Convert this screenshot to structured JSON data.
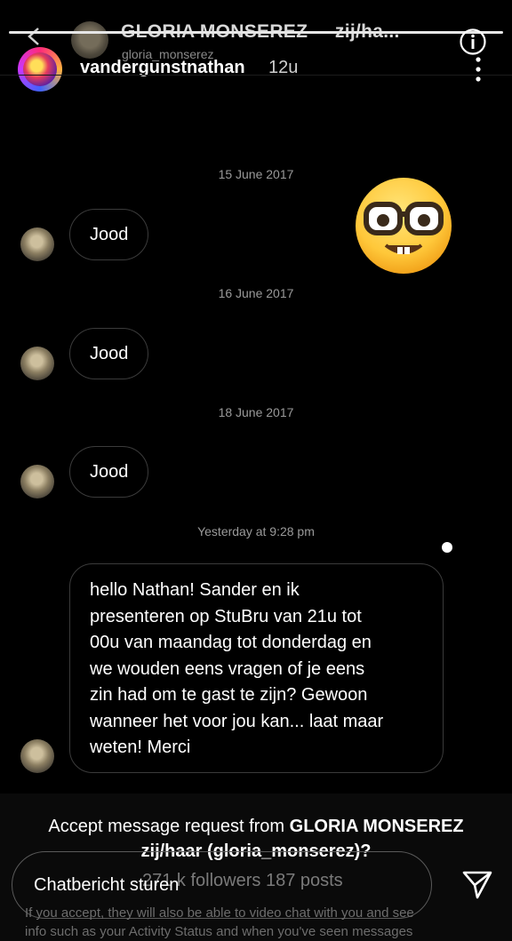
{
  "header": {
    "dm_title": "GLORIA MONSEREZ",
    "dm_title_suffix": "zij/ha...",
    "dm_username": "gloria_monserez",
    "story_username": "vandergunstnathan",
    "time_ago": "12u",
    "icons": {
      "back": "chevron-left-icon",
      "info": "info-icon",
      "more": "more-vertical-icon"
    }
  },
  "messages": [
    {
      "date": "15 June 2017",
      "text": "Jood"
    },
    {
      "date": "16 June 2017",
      "text": "Jood"
    },
    {
      "date": "18 June 2017",
      "text": "Jood"
    }
  ],
  "last_message": {
    "date": "Yesterday at 9:28 pm",
    "lines": [
      "hello Nathan! Sander en ik",
      "presenteren op StuBru van 21u tot",
      "00u van maandag tot donderdag en",
      "we wouden eens vragen of je eens",
      "zin had om te gast te zijn? Gewoon",
      "wanneer het voor jou kan... laat maar",
      "weten! Merci"
    ]
  },
  "sticker": "nerd-face-emoji",
  "request": {
    "prefix": "Accept message request from ",
    "name": "GLORIA MONSEREZ",
    "line2": "zij/haar (gloria_monserez)?",
    "followers": "271 k followers 187 posts",
    "fine_print_1": "If you accept, they will also be able to video chat with you and see",
    "fine_print_2": "info such as your Activity Status and when you've seen messages"
  },
  "composer": {
    "placeholder": "Chatbericht sturen",
    "send_icon": "send-icon"
  }
}
